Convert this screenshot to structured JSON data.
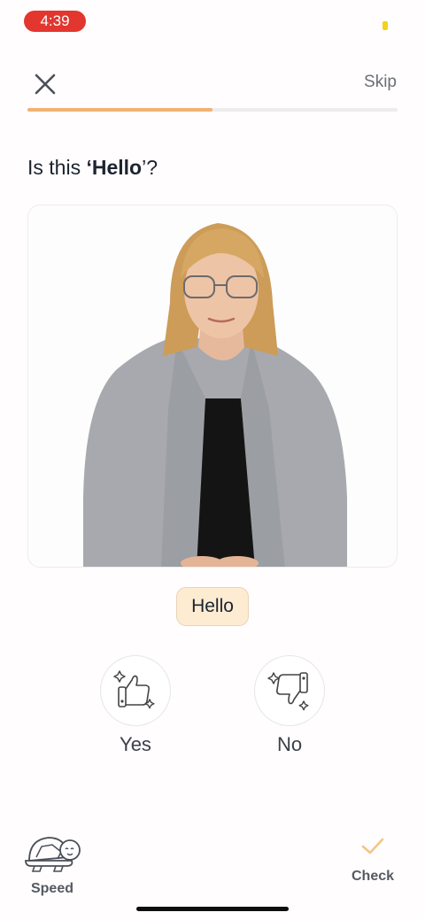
{
  "status": {
    "time": "4:39"
  },
  "header": {
    "skip_label": "Skip"
  },
  "progress": {
    "fraction": 0.5
  },
  "question": {
    "prefix": "Is this ",
    "open_quote": "‘",
    "word": "Hello",
    "close_quote": "’",
    "suffix": "?"
  },
  "video": {
    "description_icon": "person-signing-video"
  },
  "answer_chip": {
    "label": "Hello"
  },
  "choices": {
    "yes_label": "Yes",
    "no_label": "No"
  },
  "footer": {
    "speed_label": "Speed",
    "check_label": "Check"
  },
  "colors": {
    "accent": "#f0b272",
    "status_red": "#e2362f",
    "chip_bg": "#fdebd2"
  }
}
